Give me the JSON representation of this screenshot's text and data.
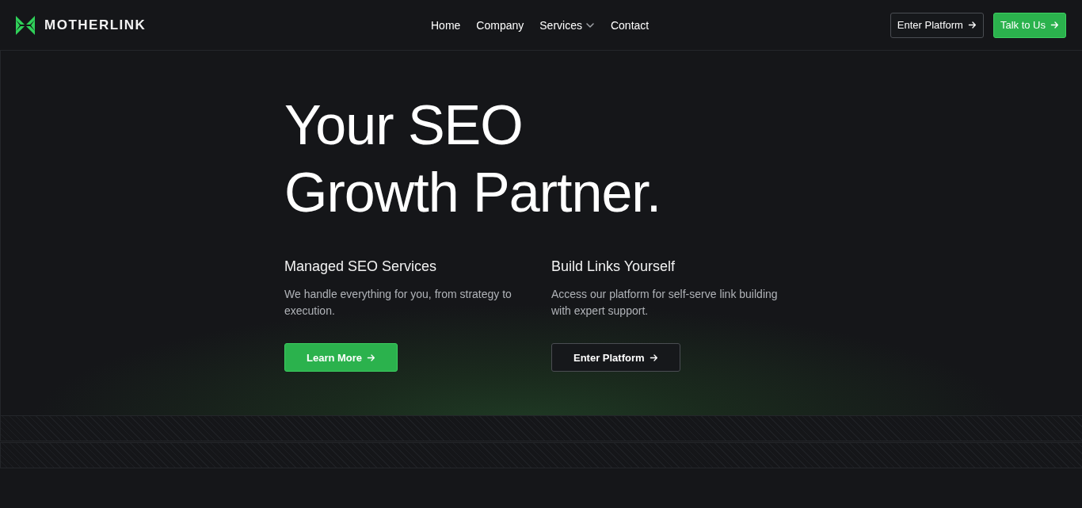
{
  "brand": {
    "name": "MOTHERLINK"
  },
  "nav": [
    {
      "label": "Home",
      "has_dropdown": false
    },
    {
      "label": "Company",
      "has_dropdown": false
    },
    {
      "label": "Services",
      "has_dropdown": true
    },
    {
      "label": "Contact",
      "has_dropdown": false
    }
  ],
  "header_buttons": [
    {
      "label": "Enter Platform",
      "kind": "outline"
    },
    {
      "label": "Talk to Us",
      "kind": "primary"
    }
  ],
  "hero": {
    "title_lines": [
      "Your SEO",
      "Growth Partner."
    ],
    "columns": [
      {
        "heading": "Managed SEO Services",
        "text": "We handle everything for you, from strategy to execution.",
        "button": {
          "label": "Learn More",
          "kind": "primary"
        }
      },
      {
        "heading": "Build Links Yourself",
        "text": "Access our platform for self-serve link building with expert support.",
        "button": {
          "label": "Enter Platform",
          "kind": "outline"
        }
      }
    ]
  }
}
